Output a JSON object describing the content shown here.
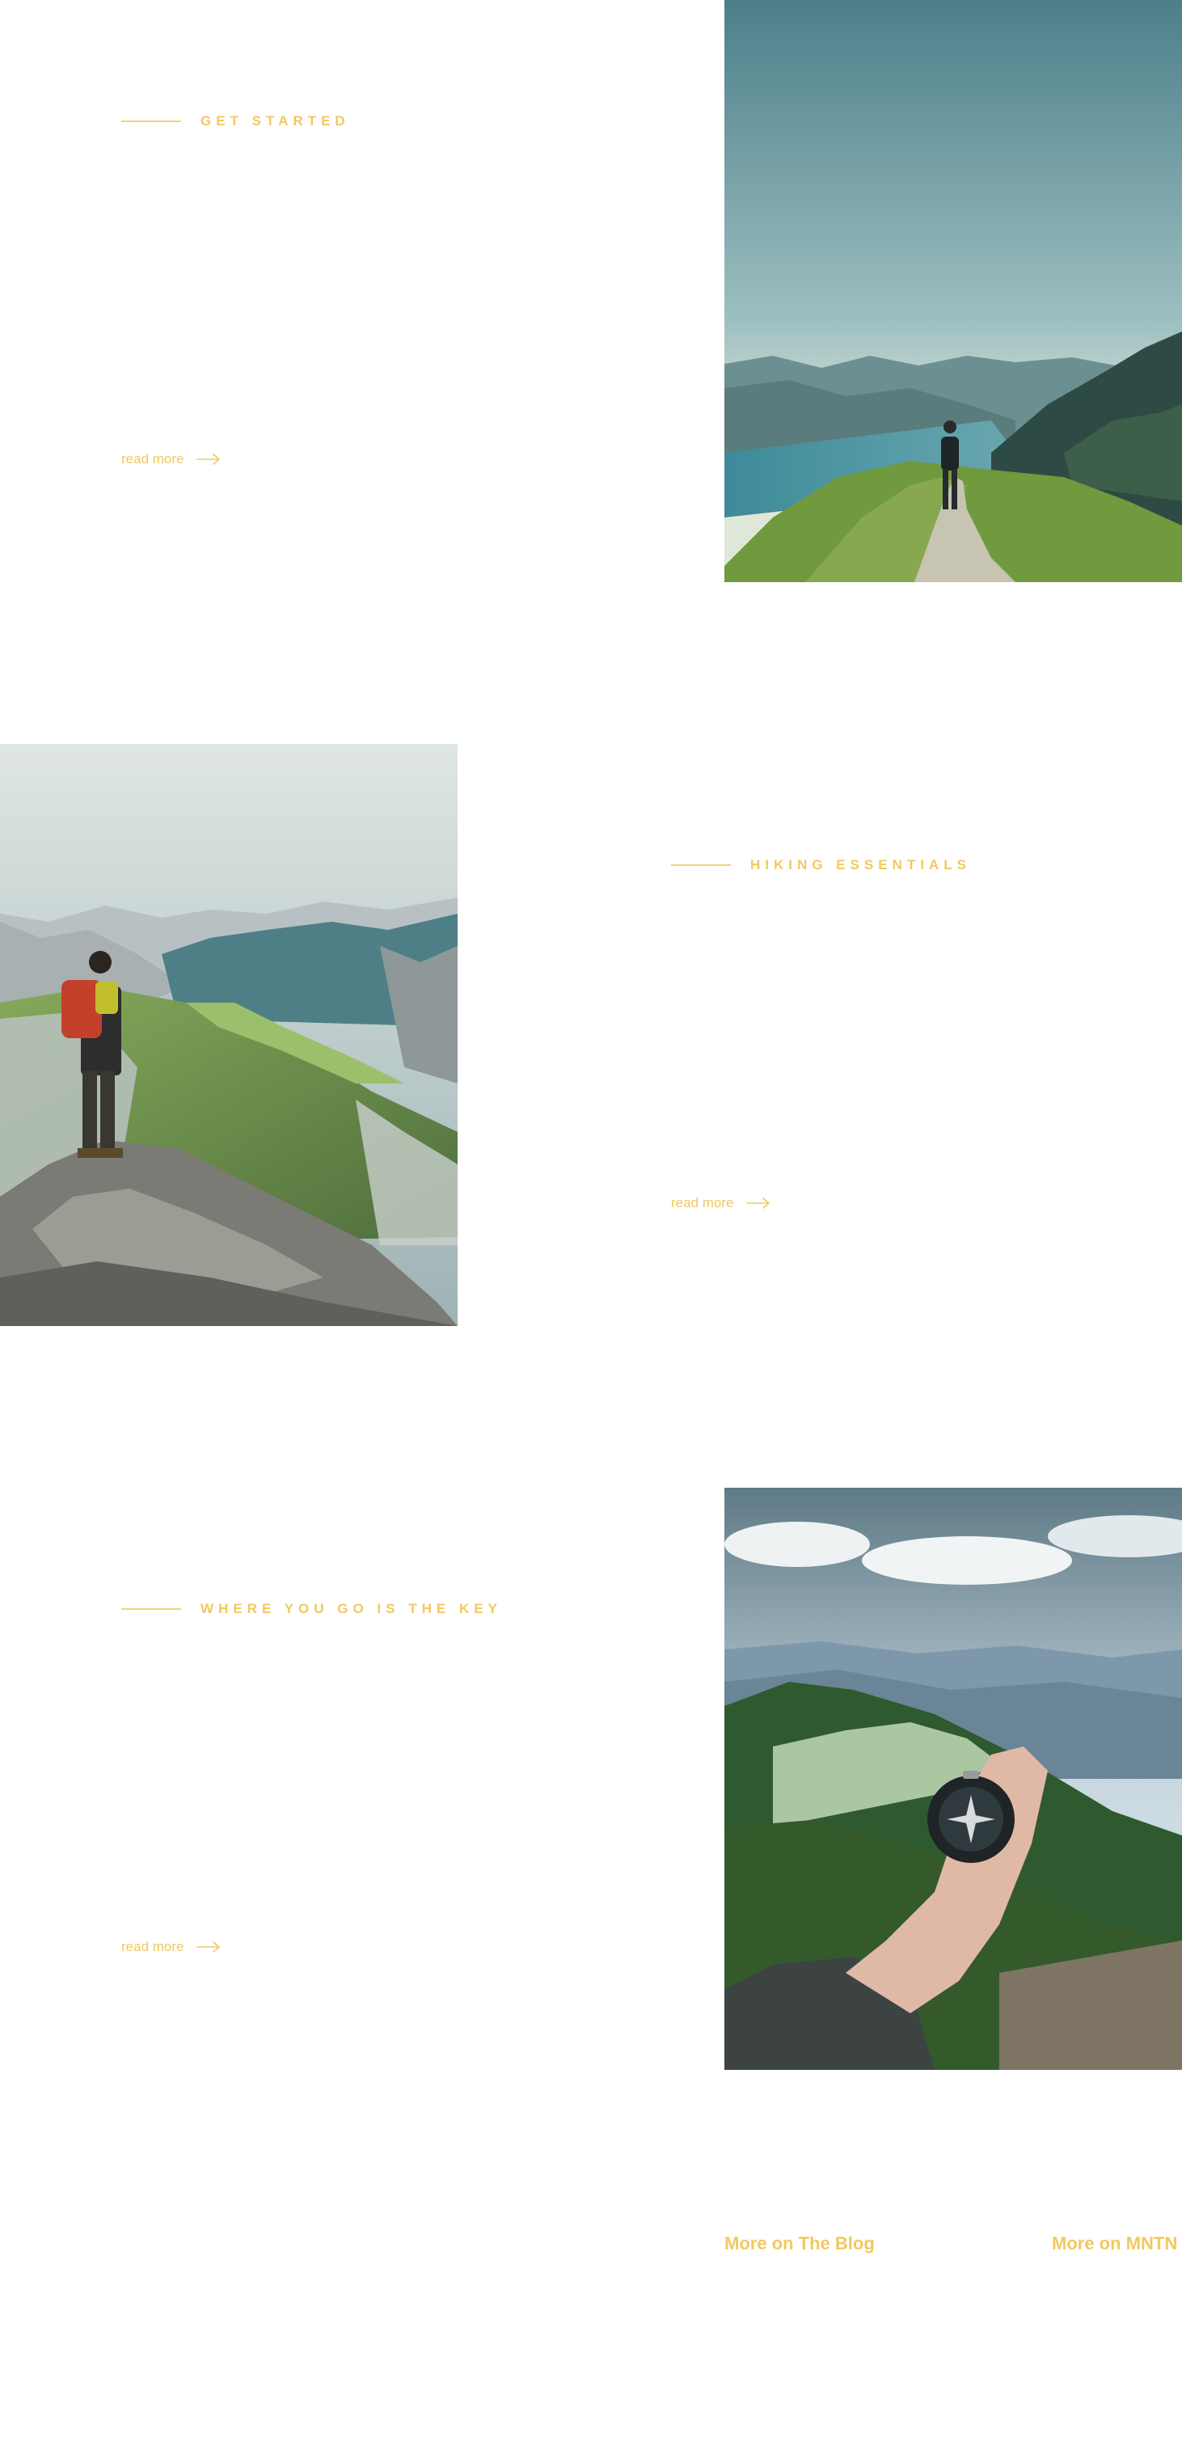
{
  "sections": [
    {
      "eyebrow": "GET STARTED",
      "read_more": "read more",
      "photo": "hiker-on-ridge-trail-photo"
    },
    {
      "eyebrow": "HIKING ESSENTIALS",
      "read_more": "read more",
      "photo": "hiker-on-rocky-summit-photo"
    },
    {
      "eyebrow": "WHERE YOU GO IS THE KEY",
      "read_more": "read more",
      "photo": "hand-holding-compass-photo"
    }
  ],
  "footer": {
    "links": [
      "More on The Blog",
      "More on MNTN"
    ]
  },
  "colors": {
    "accent": "#f2c860",
    "accent_line": "#f2d37e",
    "background": "#ffffff"
  },
  "icons": {
    "read_more": "arrow-right-icon"
  }
}
